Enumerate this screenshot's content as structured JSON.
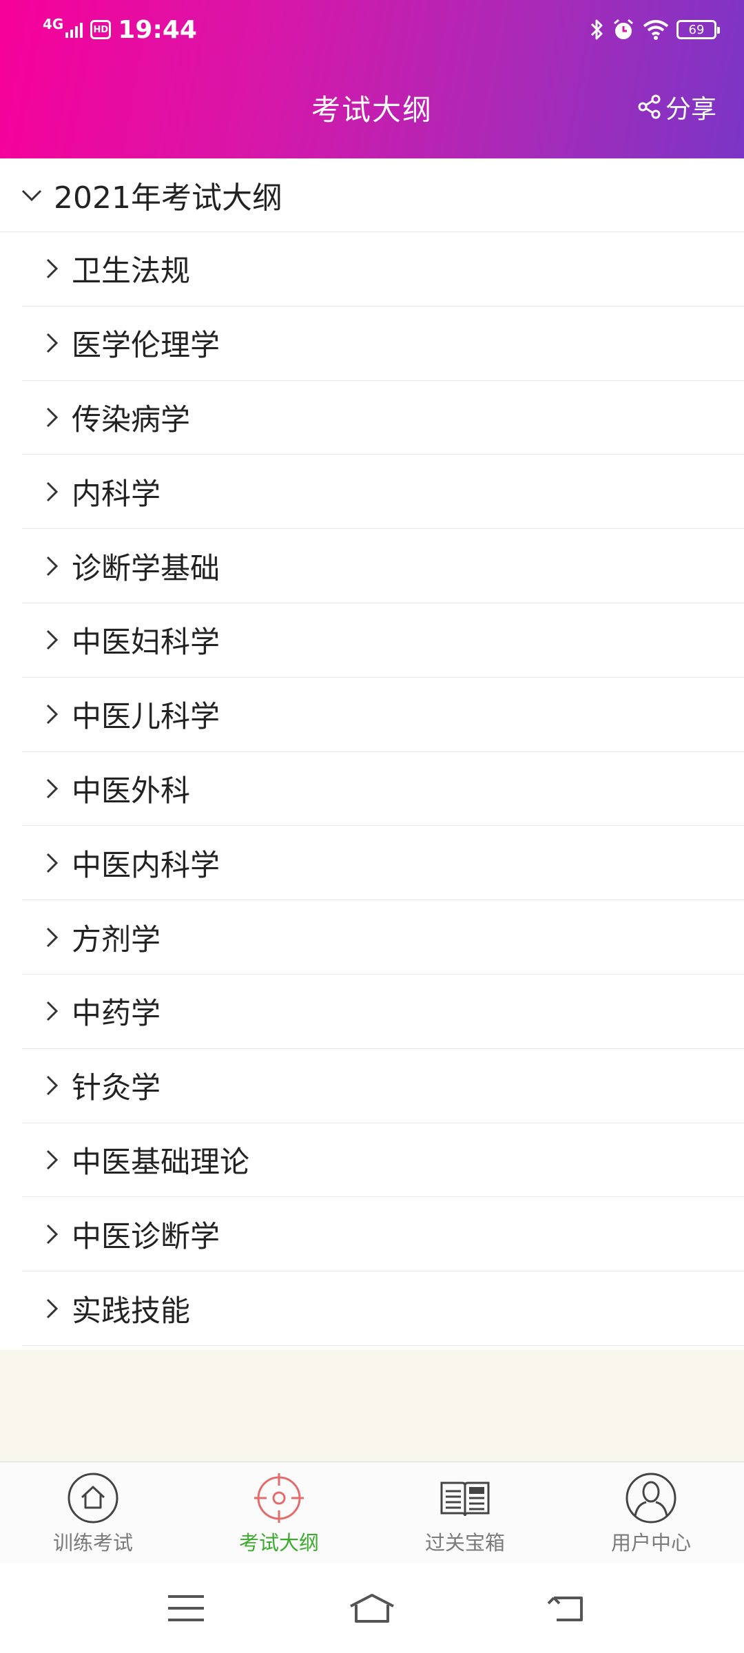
{
  "status_bar": {
    "network": "4G",
    "hd": "HD",
    "time": "19:44",
    "battery": "69"
  },
  "header": {
    "title": "考试大纲",
    "share_label": "分享"
  },
  "section": {
    "year_label": "2021年考试大纲"
  },
  "items": [
    "卫生法规",
    "医学伦理学",
    "传染病学",
    "内科学",
    "诊断学基础",
    "中医妇科学",
    "中医儿科学",
    "中医外科",
    "中医内科学",
    "方剂学",
    "中药学",
    "针灸学",
    "中医基础理论",
    "中医诊断学",
    "实践技能"
  ],
  "tabbar": {
    "tabs": [
      {
        "label": "训练考试",
        "icon": "home-icon"
      },
      {
        "label": "考试大纲",
        "icon": "target-icon",
        "active": true
      },
      {
        "label": "过关宝箱",
        "icon": "news-book-icon"
      },
      {
        "label": "用户中心",
        "icon": "user-icon"
      }
    ]
  },
  "colors": {
    "active_tab": "#3bab2d",
    "header_start": "#f7019a",
    "header_end": "#7b35c6",
    "target_icon": "#e36b6b"
  }
}
